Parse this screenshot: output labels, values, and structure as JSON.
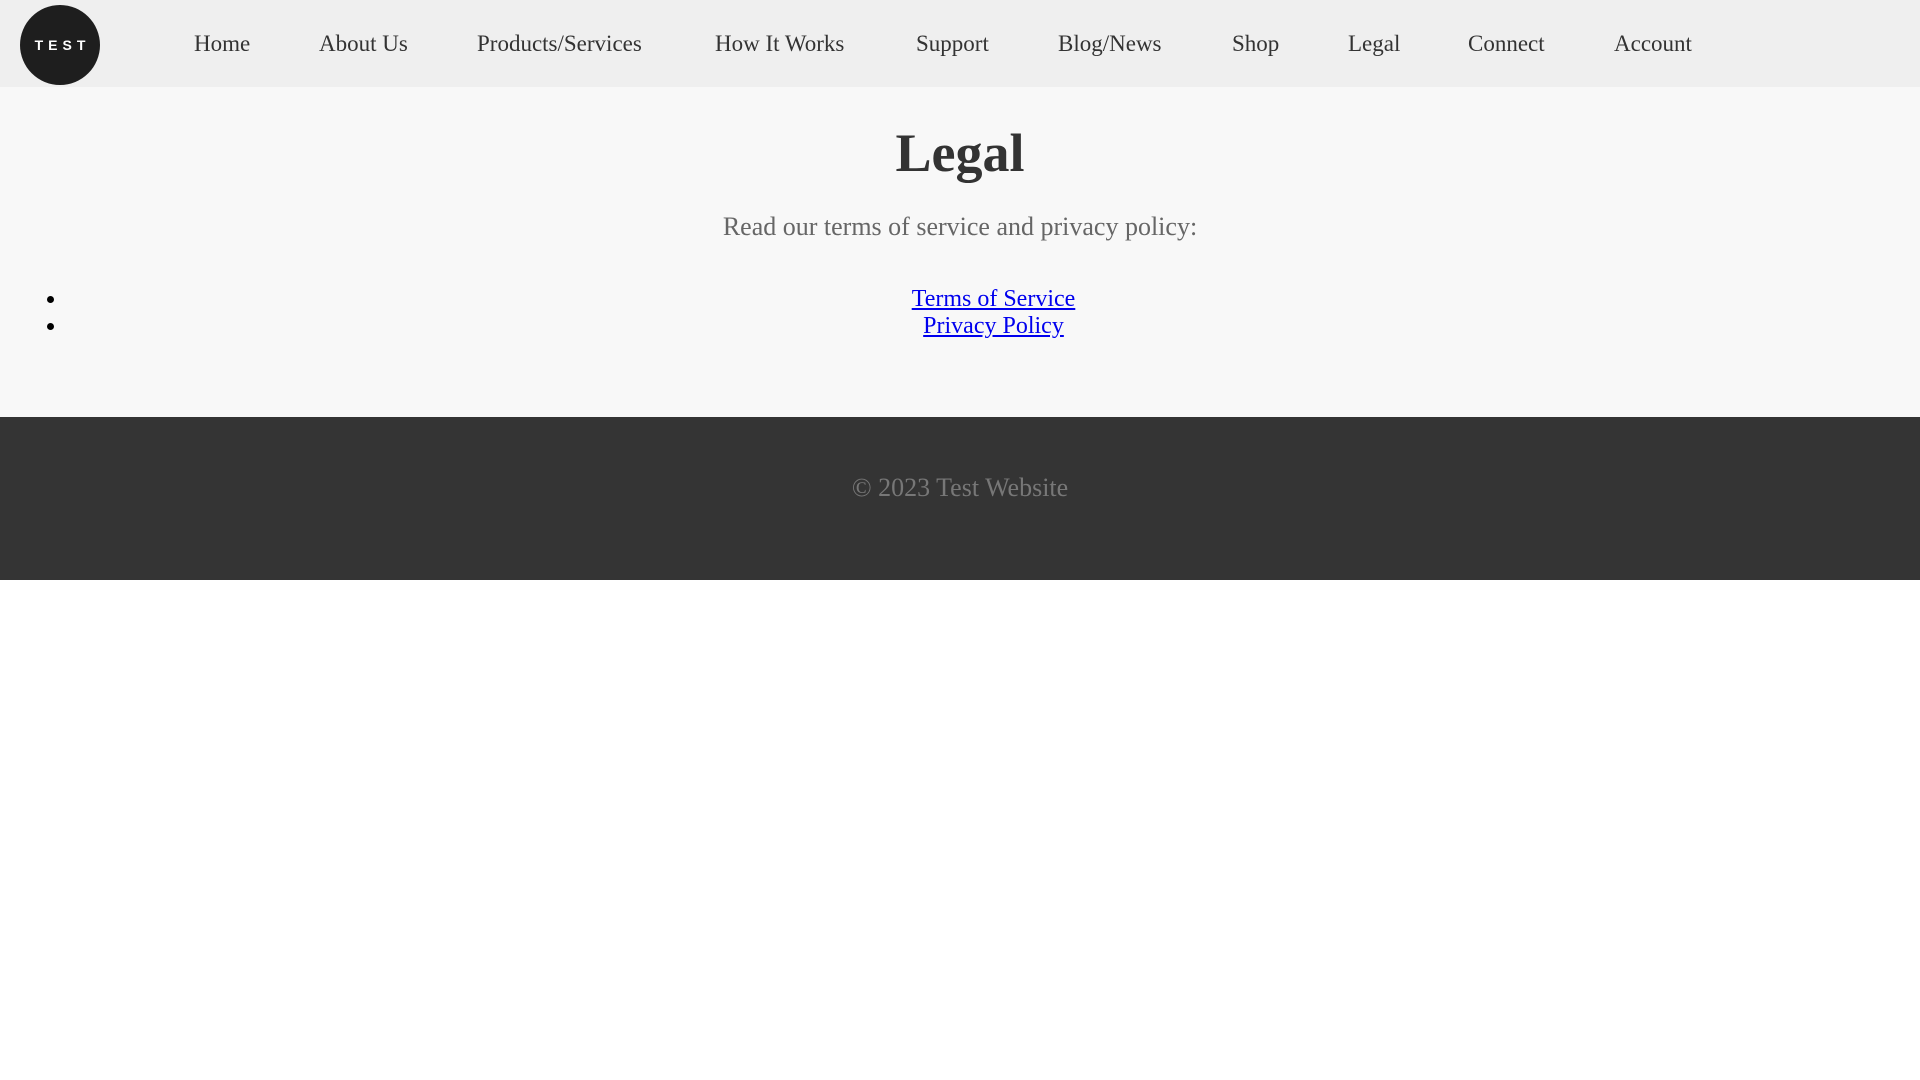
{
  "nav": {
    "logo_text": "TEST",
    "items": [
      {
        "label": "Home"
      },
      {
        "label": "About Us"
      },
      {
        "label": "Products/Services"
      },
      {
        "label": "How It Works"
      },
      {
        "label": "Support"
      },
      {
        "label": "Blog/News"
      },
      {
        "label": "Shop"
      },
      {
        "label": "Legal"
      },
      {
        "label": "Connect"
      },
      {
        "label": "Account"
      }
    ]
  },
  "main": {
    "title": "Legal",
    "intro": "Read our terms of service and privacy policy:",
    "links": [
      {
        "label": "Terms of Service"
      },
      {
        "label": "Privacy Policy"
      }
    ]
  },
  "footer": {
    "copyright": "© 2023 Test Website"
  },
  "colors": {
    "nav_bg": "#efefef",
    "main_bg": "#f8f8f8",
    "footer_bg": "#343434",
    "logo_bg": "#1e1e1e",
    "link": "#0000ee"
  }
}
